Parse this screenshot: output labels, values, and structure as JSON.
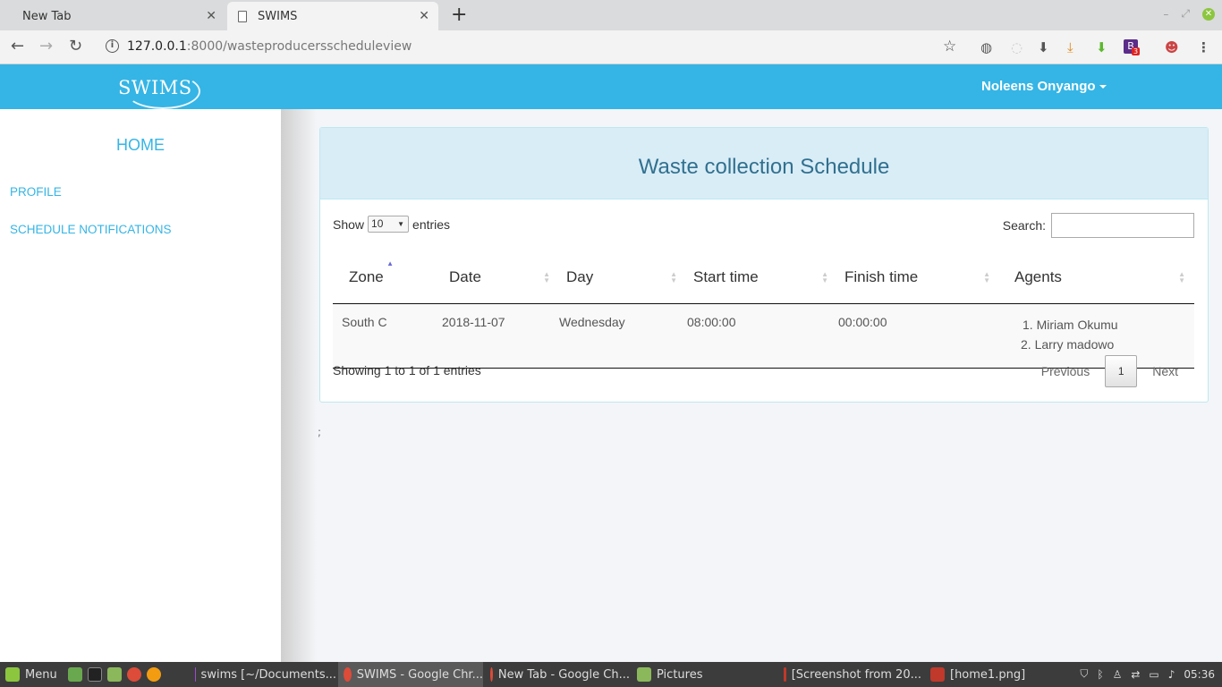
{
  "browser": {
    "tabs": [
      {
        "title": "New Tab",
        "active": false
      },
      {
        "title": "SWIMS",
        "active": true
      }
    ],
    "url_host": "127.0.0.1",
    "url_path": ":8000/wasteproducersscheduleview",
    "extension_badge": "3"
  },
  "header": {
    "logo": "SWIMS",
    "user_name": "Noleens Onyango"
  },
  "sidebar": {
    "home": "HOME",
    "items": [
      {
        "label": "PROFILE"
      },
      {
        "label": "SCHEDULE NOTIFICATIONS"
      }
    ]
  },
  "panel": {
    "title": "Waste collection Schedule",
    "length_label_pre": "Show",
    "length_value": "10",
    "length_label_post": "entries",
    "search_label": "Search:",
    "columns": [
      "Zone",
      "Date",
      "Day",
      "Start time",
      "Finish time",
      "Agents"
    ],
    "rows": [
      {
        "zone": "South C",
        "date": "2018-11-07",
        "day": "Wednesday",
        "start": "08:00:00",
        "finish": "00:00:00",
        "agents": [
          "1. Miriam Okumu",
          "2. Larry madowo"
        ]
      }
    ],
    "info": "Showing 1 to 1 of 1 entries",
    "pager": {
      "previous": "Previous",
      "current": "1",
      "next": "Next"
    }
  },
  "stray_text": ";",
  "taskbar": {
    "menu": "Menu",
    "items": [
      {
        "label": "swims [~/Documents..."
      },
      {
        "label": "SWIMS - Google Chr..."
      },
      {
        "label": "New Tab - Google Ch..."
      },
      {
        "label": "Pictures"
      },
      {
        "label": "[Screenshot from 20..."
      },
      {
        "label": "[home1.png]"
      }
    ],
    "clock": "05:36"
  },
  "colors": {
    "accent": "#35b5e5",
    "panel_heading_bg": "#d9edf7",
    "panel_title": "#31708f"
  }
}
